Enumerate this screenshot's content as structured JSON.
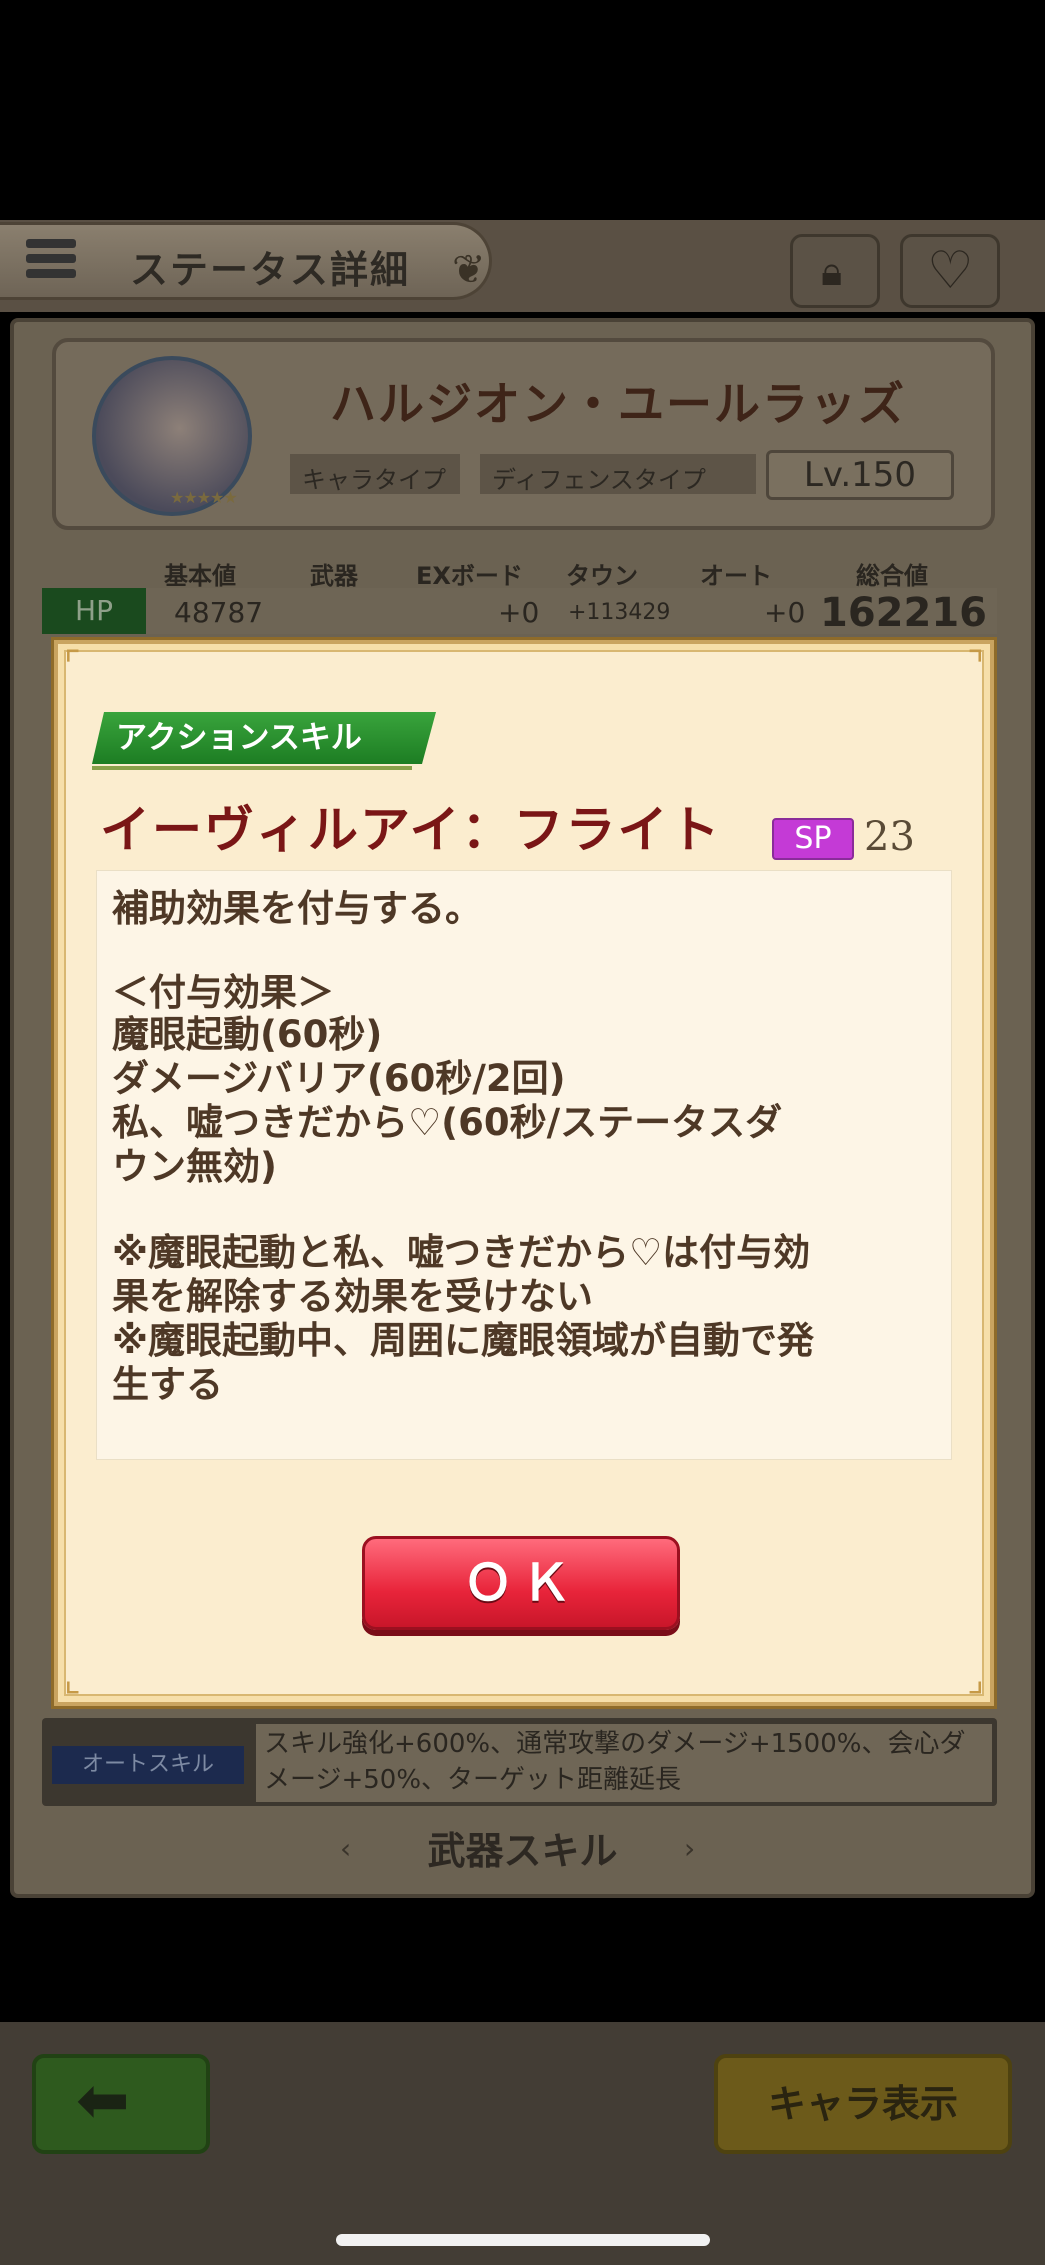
{
  "header": {
    "title": "ステータス詳細"
  },
  "character": {
    "name": "ハルジオン・ユールラッズ",
    "type1": "キャラタイプ",
    "type2": "ディフェンスタイプ",
    "level": "Lv.150",
    "stars": "★★★★★"
  },
  "stats": {
    "headers": [
      "基本値",
      "武器",
      "EXボード",
      "タウン",
      "オート",
      "総合値"
    ],
    "hp": {
      "label": "HP",
      "base": "48787",
      "weapon": "",
      "exboard": "+0",
      "town": "+113429",
      "auto": "+0",
      "total": "162216"
    }
  },
  "auto_skill": {
    "label": "オートスキル",
    "text": "スキル強化+600%、通常攻撃のダメージ+1500%、会心ダメージ+50%、ターゲット距離延長"
  },
  "weapon_skill": {
    "label": "武器スキル"
  },
  "bottom": {
    "chara_button": "キャラ表示"
  },
  "dialog": {
    "category": "アクションスキル",
    "skill_name": "イーヴィルアイ：フライト",
    "sp_label": "SP",
    "sp_value": "23",
    "description_lines": [
      "補助効果を付与する。",
      "",
      "＜付与効果＞",
      "魔眼起動(60秒)",
      "ダメージバリア(60秒/2回)",
      "私、嘘つきだから♡(60秒/ステータスダ",
      "ウン無効)",
      "",
      "※魔眼起動と私、嘘つきだから♡は付与効",
      "果を解除する効果を受けない",
      "※魔眼起動中、周囲に魔眼領域が自動で発",
      "生する"
    ],
    "ok_label": "ＯＫ"
  }
}
